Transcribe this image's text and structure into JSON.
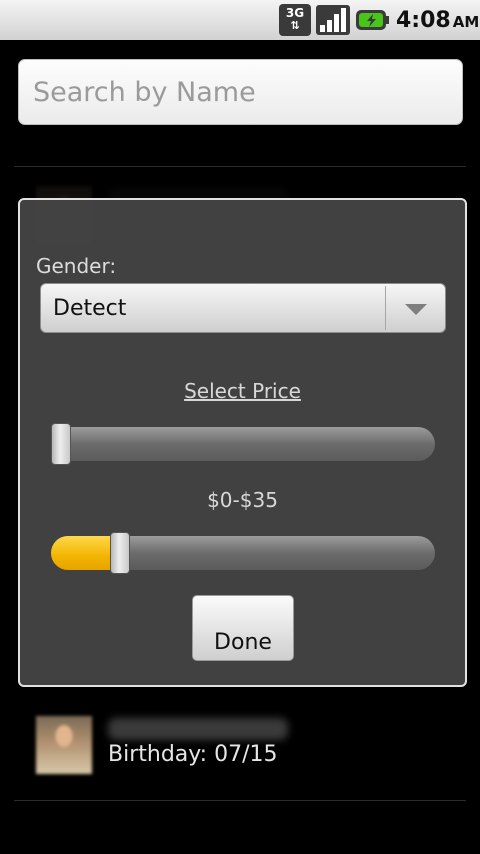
{
  "status_bar": {
    "network": "3G",
    "time": "4:08",
    "ampm": "AM"
  },
  "search": {
    "placeholder": "Search by Name"
  },
  "contacts": [
    {
      "birthday": "Birthday: 07/15"
    }
  ],
  "dialog": {
    "gender_label": "Gender:",
    "gender_value": "Detect",
    "price_link": "Select Price",
    "price_range_label": "$0-$35",
    "price_min_fraction": 0.02,
    "price_max_fraction": 0.18,
    "done_label": "Done",
    "accent_color": "#f3b400"
  }
}
